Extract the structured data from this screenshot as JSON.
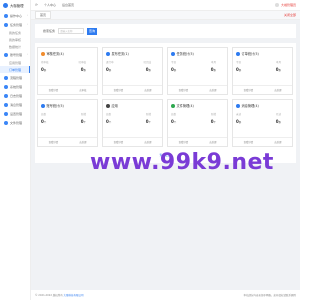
{
  "app": {
    "title": "大咖管理"
  },
  "sidebar": {
    "items": [
      {
        "label": "操作中心"
      },
      {
        "label": "任务管理"
      },
      {
        "label": "我的任务"
      },
      {
        "label": "我的审核"
      },
      {
        "label": "数据统计"
      },
      {
        "label": "账号管理"
      },
      {
        "label": "应用管理"
      },
      {
        "label": "订单管理"
      },
      {
        "label": "流程管理"
      },
      {
        "label": "系统管理"
      },
      {
        "label": "日志管理"
      },
      {
        "label": "消息管理"
      },
      {
        "label": "设置管理"
      },
      {
        "label": "文件管理"
      }
    ]
  },
  "topbar": {
    "link1": "个人中心",
    "link2": "后台首页",
    "user": "大咖管理员"
  },
  "tabbar": {
    "tab": "首页",
    "close": "关闭全部"
  },
  "search": {
    "label": "搜索任务",
    "placeholder": "请输入名称",
    "button": "查询"
  },
  "cards": [
    {
      "title": "审核任务(4)",
      "color": "#f08c2e",
      "s1": "待审核",
      "s2": "已审核",
      "n1": "0",
      "n2": "0",
      "u": "条",
      "f1": "查看详情",
      "f2": "去审核"
    },
    {
      "title": "发布任务(1)",
      "color": "#2e7bf0",
      "s1": "进行中",
      "s2": "已完成",
      "n1": "0",
      "n2": "0",
      "u": "条",
      "f1": "查看详情",
      "f2": "去处理"
    },
    {
      "title": "任务统计(5)",
      "color": "#2e7bf0",
      "s1": "今日",
      "s2": "本月",
      "n1": "0",
      "n2": "0",
      "u": "条",
      "f1": "查看详情",
      "f2": "去处理"
    },
    {
      "title": "订单统计(5)",
      "color": "#2e7bf0",
      "s1": "今日",
      "s2": "本月",
      "n1": "0",
      "n2": "0",
      "u": "条",
      "f1": "查看详情",
      "f2": "去处理"
    },
    {
      "title": "账号统计(5)",
      "color": "#2e7bf0",
      "s1": "总数",
      "s2": "新增",
      "n1": "0",
      "n2": "0",
      "u": "个",
      "f1": "查看详情",
      "f2": "去处理"
    },
    {
      "title": "应用",
      "color": "#444444",
      "s1": "总数",
      "s2": "新增",
      "n1": "0",
      "n2": "0",
      "u": "个",
      "f1": "查看详情",
      "f2": "去处理"
    },
    {
      "title": "文件管理(4)",
      "color": "#2ea84f",
      "s1": "总数",
      "s2": "新增",
      "n1": "0",
      "n2": "0",
      "u": "个",
      "f1": "查看详情",
      "f2": "去处理"
    },
    {
      "title": "消息管理(4)",
      "color": "#2e7bf0",
      "s1": "未读",
      "s2": "已读",
      "n1": "0",
      "n2": "0",
      "u": "条",
      "f1": "查看详情",
      "f2": "去处理"
    }
  ],
  "more": "查看更多",
  "footer": {
    "left": "© 2021-2022 版权所有",
    "link": "大咖科技有限公司",
    "right": "本站部分内容来源于网络，如有侵权请联系删除"
  },
  "watermark": "www.99k9.net"
}
